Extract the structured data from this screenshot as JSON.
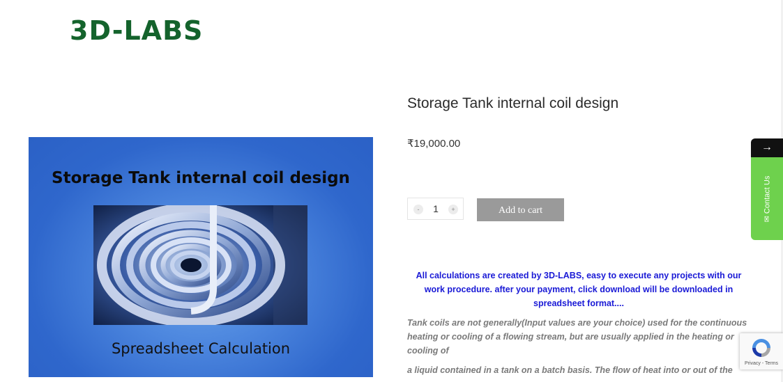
{
  "brand": {
    "logo_text": "3D-LABS",
    "logo_color": "#14632c"
  },
  "product": {
    "image": {
      "title": "Storage Tank internal coil design",
      "caption": "Spreadsheet Calculation"
    },
    "title": "Storage Tank internal coil design",
    "price": "₹19,000.00",
    "quantity": {
      "value": "1",
      "decrement_label": "-",
      "increment_label": "+"
    },
    "add_to_cart_label": "Add to cart",
    "highlight_text": "All calculations are created by 3D-LABS, easy to execute any projects with our work procedure. after your payment, click download will be downloaded in spreadsheet format....",
    "description": [
      "Tank coils are not generally(Input values are your choice) used for the continuous heating or cooling of a flowing stream, but are usually applied in the heating or cooling of",
      "a liquid contained in a tank on a batch basis. The flow of heat into or out of the"
    ]
  },
  "contact_widget": {
    "arrow_icon": "arrow-right-icon",
    "label": "✉ Contact Us",
    "color": "#6ed14d"
  },
  "recaptcha": {
    "links": "Privacy - Terms",
    "icon": "recaptcha-icon"
  },
  "colors": {
    "highlight": "#1a1ad6",
    "button": "#9a9a9a",
    "image_background": "#2f67cc"
  }
}
